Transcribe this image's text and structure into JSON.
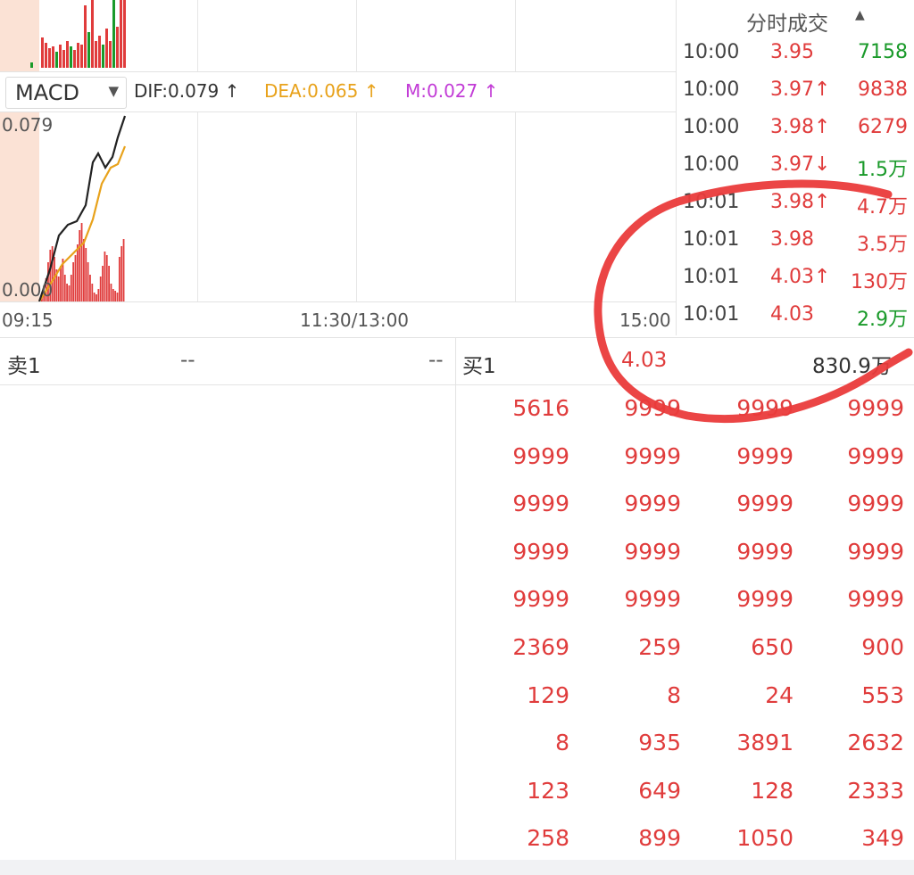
{
  "macd": {
    "selector": "MACD",
    "dif": "DIF:0.079 ↑",
    "dea": "DEA:0.065 ↑",
    "m": "M:0.027 ↑",
    "y_top": "0.079",
    "y_bottom": "0.000"
  },
  "time_axis": {
    "start": "09:15",
    "mid": "11:30/13:00",
    "end": "15:00"
  },
  "trades": {
    "title": "分时成交",
    "sort_icon": "triangle-up-icon",
    "rows": [
      {
        "time": "10:00",
        "price": "3.95",
        "price_color": "red",
        "volume": "7158",
        "volume_color": "green"
      },
      {
        "time": "10:00",
        "price": "3.97↑",
        "price_color": "red",
        "volume": "9838",
        "volume_color": "red"
      },
      {
        "time": "10:00",
        "price": "3.98↑",
        "price_color": "red",
        "volume": "6279",
        "volume_color": "red"
      },
      {
        "time": "10:00",
        "price": "3.97↓",
        "price_color": "red",
        "volume": "1.5万",
        "volume_color": "green"
      },
      {
        "time": "10:01",
        "price": "3.98↑",
        "price_color": "red",
        "volume": "4.7万",
        "volume_color": "red"
      },
      {
        "time": "10:01",
        "price": "3.98",
        "price_color": "red",
        "volume": "3.5万",
        "volume_color": "red"
      },
      {
        "time": "10:01",
        "price": "4.03↑",
        "price_color": "red",
        "volume": "130万",
        "volume_color": "red"
      },
      {
        "time": "10:01",
        "price": "4.03",
        "price_color": "red",
        "volume": "2.9万",
        "volume_color": "green"
      }
    ]
  },
  "order_book": {
    "sell_label": "卖1",
    "sell_price": "--",
    "sell_volume": "--",
    "buy_label": "买1",
    "buy_price": "4.03",
    "buy_volume": "830.9万",
    "queue": [
      [
        "5616",
        "9999",
        "9999",
        "9999"
      ],
      [
        "9999",
        "9999",
        "9999",
        "9999"
      ],
      [
        "9999",
        "9999",
        "9999",
        "9999"
      ],
      [
        "9999",
        "9999",
        "9999",
        "9999"
      ],
      [
        "9999",
        "9999",
        "9999",
        "9999"
      ],
      [
        "2369",
        "259",
        "650",
        "900"
      ],
      [
        "129",
        "8",
        "24",
        "553"
      ],
      [
        "8",
        "935",
        "3891",
        "2632"
      ],
      [
        "123",
        "649",
        "128",
        "2333"
      ],
      [
        "258",
        "899",
        "1050",
        "349"
      ]
    ]
  },
  "colors": {
    "up": "#e03c3c",
    "down": "#1a9a2a",
    "dea_line": "#e8a21b",
    "m_text": "#c23bd6",
    "dif_line": "#222222",
    "annotation": "#ea3b3b"
  }
}
